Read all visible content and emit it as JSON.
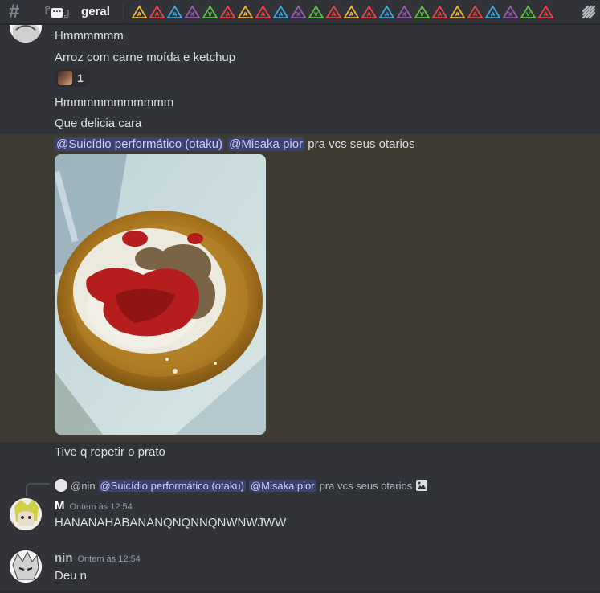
{
  "channel": {
    "bracket_left": "『",
    "bracket_right": "』",
    "name": "geral",
    "topic_icons": [
      {
        "color": "#f0b232",
        "letter": "A"
      },
      {
        "color": "#ed4245",
        "letter": "A"
      },
      {
        "color": "#3ba5dd",
        "letter": "A"
      },
      {
        "color": "#9b59b6",
        "letter": "X"
      },
      {
        "color": "#57c13a",
        "letter": "V"
      },
      {
        "color": "#ed4245",
        "letter": "A"
      },
      {
        "color": "#f0b232",
        "letter": "A"
      },
      {
        "color": "#ed4245",
        "letter": "A"
      },
      {
        "color": "#3ba5dd",
        "letter": "A"
      },
      {
        "color": "#9b59b6",
        "letter": "X"
      },
      {
        "color": "#57c13a",
        "letter": "V"
      },
      {
        "color": "#ed4245",
        "letter": "A"
      },
      {
        "color": "#f0b232",
        "letter": "A"
      },
      {
        "color": "#ed4245",
        "letter": "A"
      },
      {
        "color": "#3ba5dd",
        "letter": "A"
      },
      {
        "color": "#9b59b6",
        "letter": "X"
      },
      {
        "color": "#57c13a",
        "letter": "V"
      },
      {
        "color": "#ed4245",
        "letter": "A"
      },
      {
        "color": "#f0b232",
        "letter": "A"
      },
      {
        "color": "#ed4245",
        "letter": "A"
      },
      {
        "color": "#3ba5dd",
        "letter": "A"
      },
      {
        "color": "#9b59b6",
        "letter": "X"
      },
      {
        "color": "#57c13a",
        "letter": "V"
      },
      {
        "color": "#ed4245",
        "letter": "A"
      }
    ]
  },
  "messages": {
    "line1": "Hmmmmmm",
    "line2": "Arroz com carne moída e ketchup",
    "reaction_count": "1",
    "line3": "Hmmmmmmmmmmm",
    "line4": "Que delicia cara",
    "mention1": "@Suicídio performático (otaku)",
    "mention2": "@Misaka pior",
    "mention_tail": "pra vcs seus otarios",
    "line5": "Tive q repetir o prato"
  },
  "reply": {
    "author": "@nin",
    "mention1": "@Suicídio performático (otaku)",
    "mention2": "@Misaka pior",
    "tail": "pra vcs seus otarios"
  },
  "msg_m": {
    "author": "M",
    "author_color": "#ffffff",
    "time": "Ontem às 12:54",
    "text": "HANANAHABANANQNQNNQNWNWJWW"
  },
  "msg_nin": {
    "author": "nin",
    "author_color": "#b8bbbf",
    "time": "Ontem às 12:54",
    "text": "Deu n"
  }
}
